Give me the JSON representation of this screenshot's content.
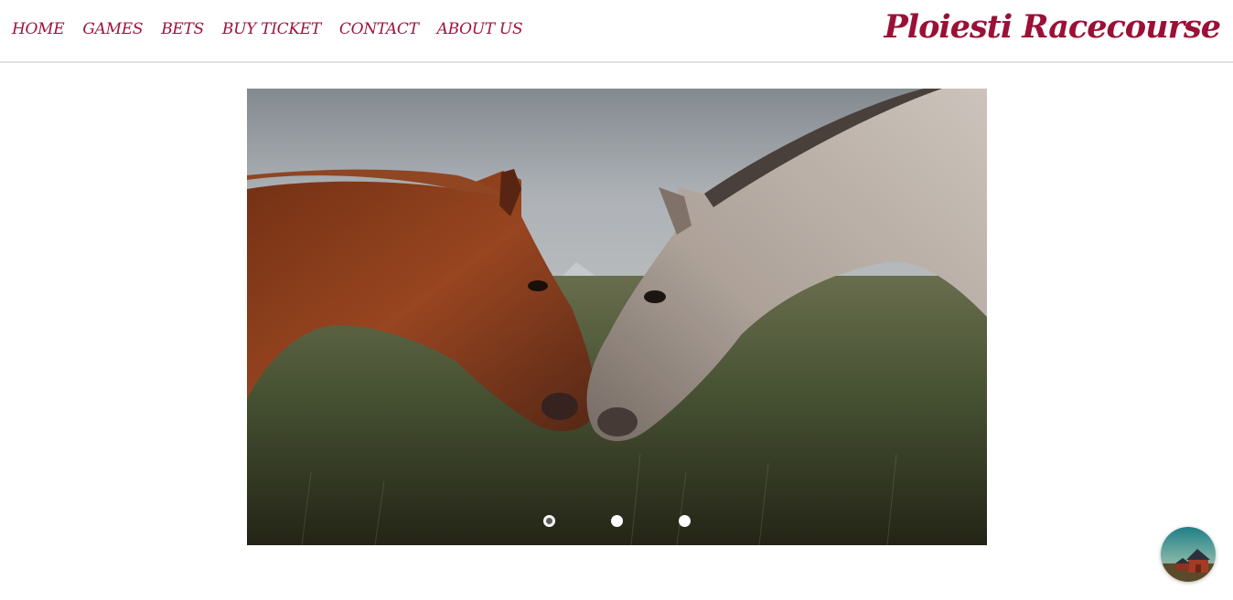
{
  "nav": {
    "items": [
      "HOME",
      "GAMES",
      "BETS",
      "BUY TICKET",
      "CONTACT",
      "ABOUT US"
    ]
  },
  "brand": {
    "name": "Ploiesti Racecourse"
  },
  "slider": {
    "image": "two-horses-touching-noses",
    "slide_count": 3,
    "active_index": 0
  },
  "chat": {
    "avatar": "barn-landscape-avatar"
  },
  "colors": {
    "accent": "#9b1036",
    "border": "#e3e3e3"
  }
}
